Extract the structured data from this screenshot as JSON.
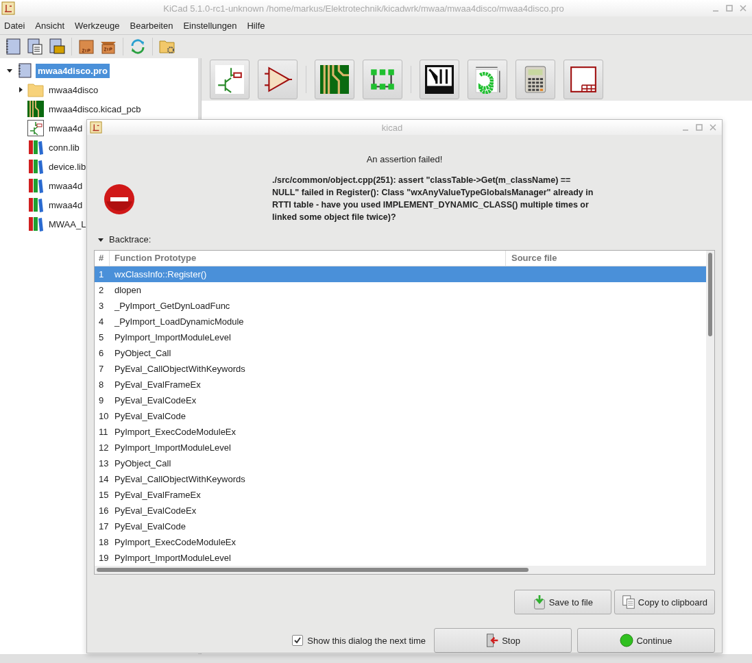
{
  "window": {
    "title": "KiCad 5.1.0-rc1-unknown /home/markus/Elektrotechnik/kicadwrk/mwaa/mwaa4disco/mwaa4disco.pro"
  },
  "menu": [
    "Datei",
    "Ansicht",
    "Werkzeuge",
    "Bearbeiten",
    "Einstellungen",
    "Hilfe"
  ],
  "tree": [
    {
      "label": "mwaa4disco.pro",
      "kind": "project",
      "selected": true,
      "expanded": true,
      "children": [
        {
          "label": "mwaa4disco",
          "kind": "folder",
          "selected": false,
          "expanded": false
        },
        {
          "label": "mwaa4disco.kicad_pcb",
          "kind": "pcb",
          "selected": false
        },
        {
          "label": "mwaa4d",
          "kind": "schematic",
          "selected": false
        },
        {
          "label": "conn.lib",
          "kind": "library",
          "selected": false
        },
        {
          "label": "device.lib",
          "kind": "library",
          "selected": false
        },
        {
          "label": "mwaa4d",
          "kind": "library",
          "selected": false
        },
        {
          "label": "mwaa4d",
          "kind": "library",
          "selected": false
        },
        {
          "label": "MWAA_L",
          "kind": "library",
          "selected": false
        }
      ]
    }
  ],
  "dialog": {
    "title": "kicad",
    "heading": "An assertion failed!",
    "message": "./src/common/object.cpp(251): assert \"classTable->Get(m_className) == NULL\" failed in Register(): Class \"wxAnyValueTypeGlobalsManager\" already in RTTI table - have you used IMPLEMENT_DYNAMIC_CLASS() multiple times or linked some object file twice)?",
    "backtrace_label": "Backtrace:",
    "backtrace_expanded": true,
    "columns": [
      "#",
      "Function Prototype",
      "Source file"
    ],
    "rows": [
      {
        "number": "1",
        "function": "wxClassInfo::Register()",
        "selected": true
      },
      {
        "number": "2",
        "function": "dlopen",
        "selected": false
      },
      {
        "number": "3",
        "function": "_PyImport_GetDynLoadFunc",
        "selected": false
      },
      {
        "number": "4",
        "function": "_PyImport_LoadDynamicModule",
        "selected": false
      },
      {
        "number": "5",
        "function": "PyImport_ImportModuleLevel",
        "selected": false
      },
      {
        "number": "6",
        "function": "PyObject_Call",
        "selected": false
      },
      {
        "number": "7",
        "function": "PyEval_CallObjectWithKeywords",
        "selected": false
      },
      {
        "number": "8",
        "function": "PyEval_EvalFrameEx",
        "selected": false
      },
      {
        "number": "9",
        "function": "PyEval_EvalCodeEx",
        "selected": false
      },
      {
        "number": "10",
        "function": "PyEval_EvalCode",
        "selected": false
      },
      {
        "number": "11",
        "function": "PyImport_ExecCodeModuleEx",
        "selected": false
      },
      {
        "number": "12",
        "function": "PyImport_ImportModuleLevel",
        "selected": false
      },
      {
        "number": "13",
        "function": "PyObject_Call",
        "selected": false
      },
      {
        "number": "14",
        "function": "PyEval_CallObjectWithKeywords",
        "selected": false
      },
      {
        "number": "15",
        "function": "PyEval_EvalFrameEx",
        "selected": false
      },
      {
        "number": "16",
        "function": "PyEval_EvalCodeEx",
        "selected": false
      },
      {
        "number": "17",
        "function": "PyEval_EvalCode",
        "selected": false
      },
      {
        "number": "18",
        "function": "PyImport_ExecCodeModuleEx",
        "selected": false
      },
      {
        "number": "19",
        "function": "PyImport_ImportModuleLevel",
        "selected": false
      }
    ],
    "tools": [
      {
        "label": "Save to file",
        "kind": "save"
      },
      {
        "label": "Copy to clipboard",
        "kind": "copy"
      }
    ],
    "checkbox": {
      "label": "Show this dialog the next time",
      "checked": true
    },
    "actions": [
      {
        "label": "Stop",
        "kind": "stop"
      },
      {
        "label": "Continue",
        "kind": "continue"
      }
    ]
  }
}
